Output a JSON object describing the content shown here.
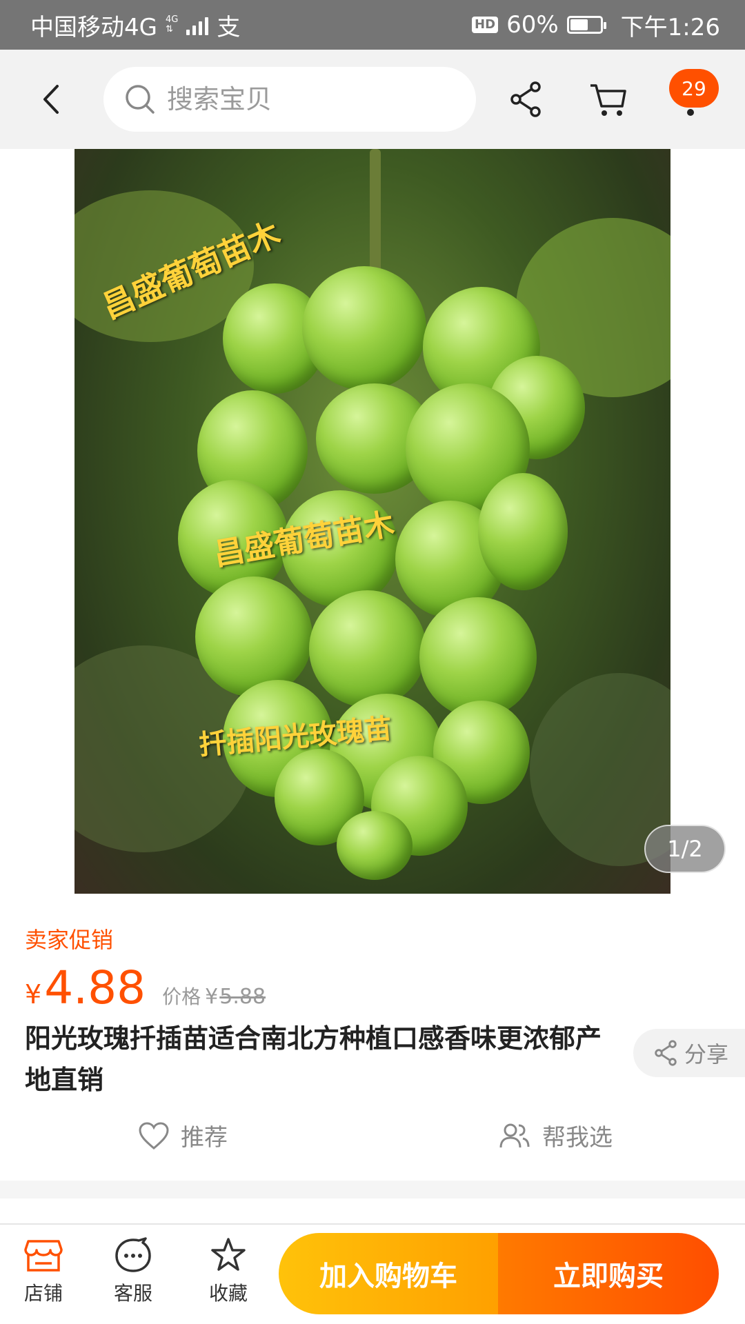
{
  "status_bar": {
    "carrier": "中国移动4G",
    "network_small": "4G",
    "alipay_glyph": "支",
    "hd": "HD",
    "battery_text": "60%",
    "battery_level": 0.6,
    "time": "下午1:26"
  },
  "nav": {
    "search_placeholder": "搜索宝贝",
    "cart_count": "29",
    "icons": [
      "back-arrow-icon",
      "search-icon",
      "share-icon",
      "cart-icon",
      "more-icon"
    ]
  },
  "gallery": {
    "overlay_texts": [
      "昌盛葡萄苗木",
      "昌盛葡萄苗木",
      "扦插阳光玫瑰苗"
    ],
    "pager": "1/2"
  },
  "product": {
    "promo_label": "卖家促销",
    "currency": "¥",
    "price": "4.88",
    "orig_label": "价格",
    "orig_currency": "¥",
    "orig_price": "5.88",
    "title": "阳光玫瑰扦插苗适合南北方种植口感香味更浓郁产地直销",
    "share_label": "分享",
    "recommend_label": "推荐",
    "help_choose_label": "帮我选"
  },
  "bottom_bar": {
    "shop_label": "店铺",
    "service_label": "客服",
    "favorite_label": "收藏",
    "add_cart_label": "加入购物车",
    "buy_now_label": "立即购买"
  },
  "colors": {
    "accent": "#ff5000",
    "cart_button": "#ffa000",
    "buy_button": "#ff4e00"
  }
}
